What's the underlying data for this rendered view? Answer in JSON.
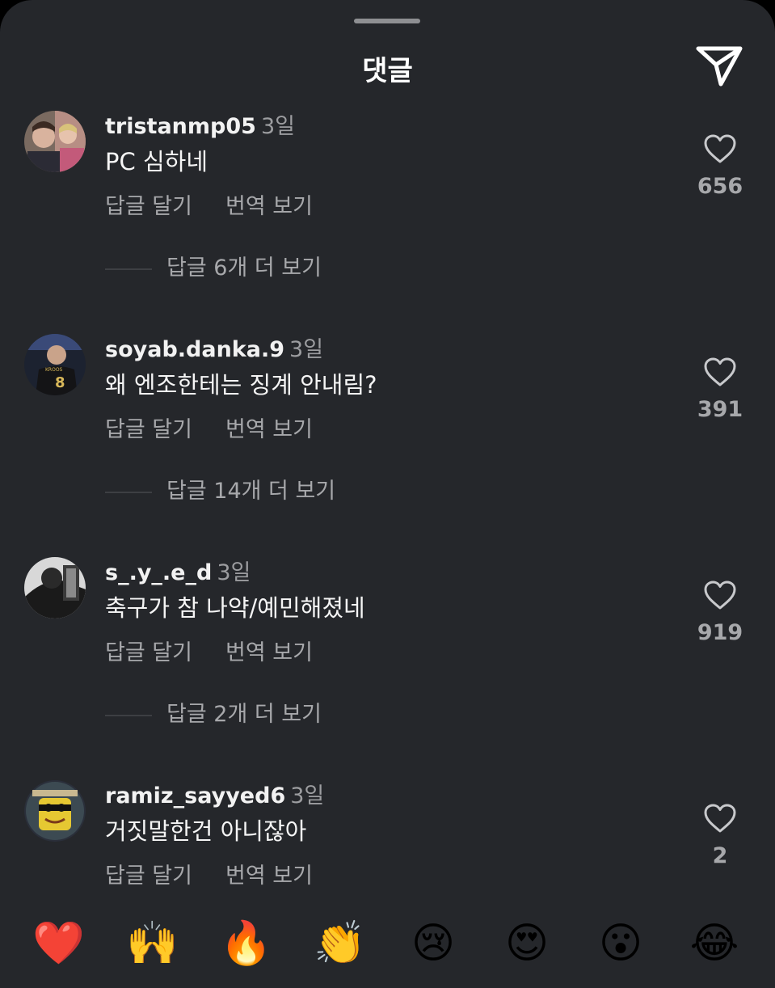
{
  "header": {
    "title": "댓글"
  },
  "comments": [
    {
      "username": "tristanmp05",
      "time": "3일",
      "text": "PC 심하네",
      "reply": "답글 달기",
      "translate": "번역 보기",
      "likes": "656",
      "more": "답글 6개 더 보기"
    },
    {
      "username": "soyab.danka.9",
      "time": "3일",
      "text": "왜 엔조한테는 징계 안내림?",
      "reply": "답글 달기",
      "translate": "번역 보기",
      "likes": "391",
      "more": "답글 14개 더 보기"
    },
    {
      "username": "s_.y_.e_d",
      "time": "3일",
      "text": "축구가 참 나약/예민해졌네",
      "reply": "답글 달기",
      "translate": "번역 보기",
      "likes": "919",
      "more": "답글 2개 더 보기"
    },
    {
      "username": "ramiz_sayyed6",
      "time": "3일",
      "text": "거짓말한건 아니잖아",
      "reply": "답글 달기",
      "translate": "번역 보기",
      "likes": "2",
      "more": ""
    }
  ],
  "emoji_bar": [
    {
      "name": "red-heart",
      "glyph": "❤️"
    },
    {
      "name": "raising-hands",
      "glyph": "🙌"
    },
    {
      "name": "fire",
      "glyph": "🔥"
    },
    {
      "name": "clapping-hands",
      "glyph": "👏"
    },
    {
      "name": "crying-face",
      "glyph": "😢"
    },
    {
      "name": "heart-eyes",
      "glyph": "😍"
    },
    {
      "name": "surprised-face",
      "glyph": "😮"
    },
    {
      "name": "tears-of-joy",
      "glyph": "😂"
    }
  ],
  "colors": {
    "background": "#25272b",
    "text": "#f5f5f5",
    "secondary": "#a7a8ab"
  }
}
